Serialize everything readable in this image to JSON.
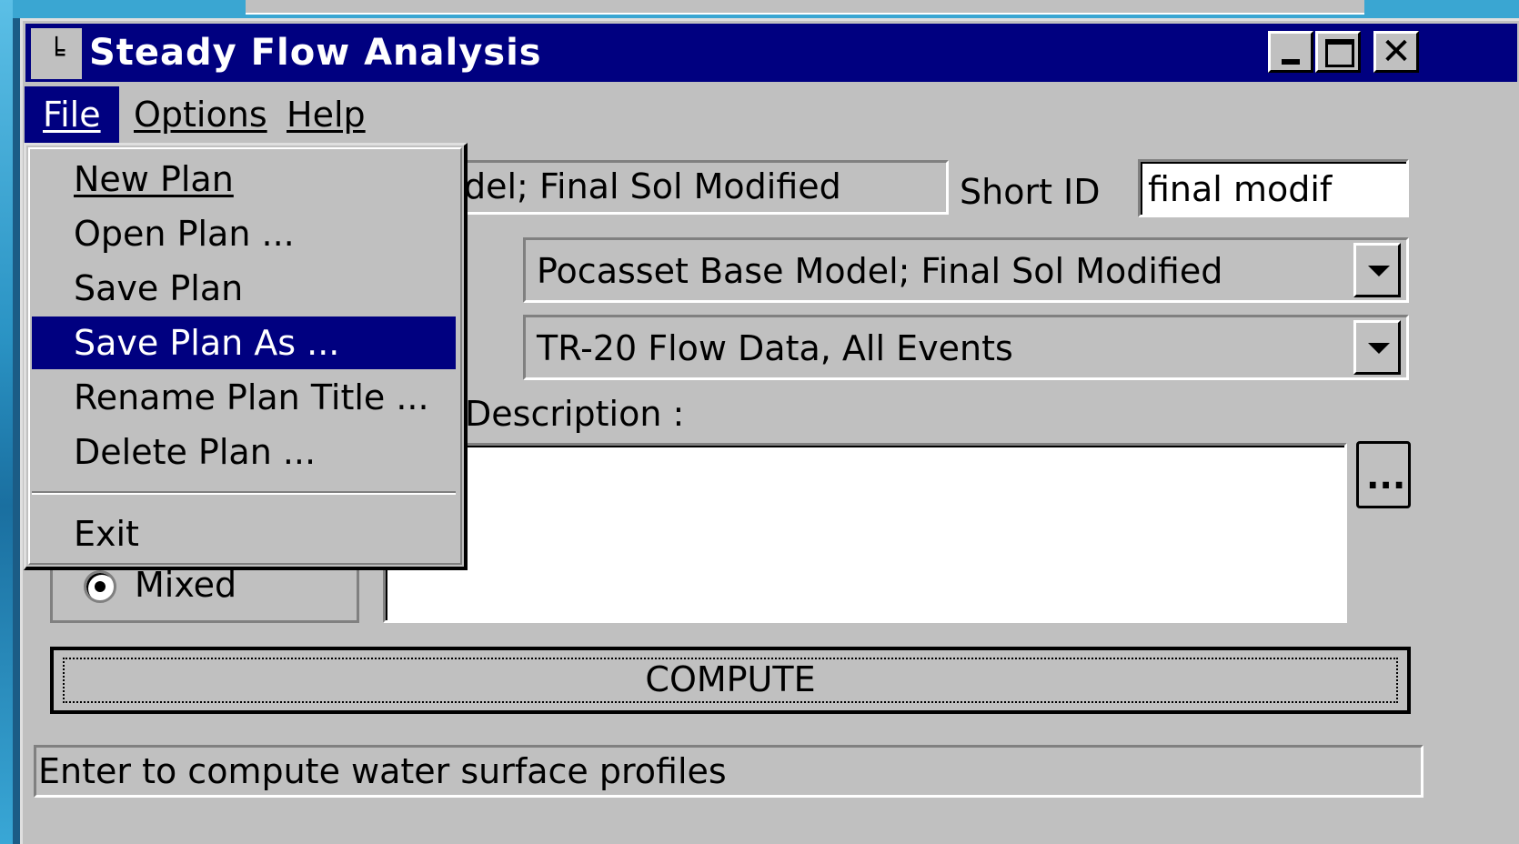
{
  "window": {
    "title": "Steady Flow Analysis",
    "icon_glyph": "╘",
    "close_glyph": "✕"
  },
  "menubar": {
    "items": [
      {
        "label": "File",
        "active": true
      },
      {
        "label": "Options",
        "active": false
      },
      {
        "label": "Help",
        "active": false
      }
    ]
  },
  "file_menu": {
    "items": [
      {
        "label": "New Plan",
        "selected": false
      },
      {
        "label": "Open Plan ...",
        "selected": false
      },
      {
        "label": "Save Plan",
        "selected": false
      },
      {
        "label": "Save Plan As ...",
        "selected": true
      },
      {
        "label": "Rename Plan Title ...",
        "selected": false
      },
      {
        "label": "Delete Plan ...",
        "selected": false
      },
      {
        "label": "Exit",
        "selected": false
      }
    ]
  },
  "plan": {
    "title_visible": "del; Final Sol Modified",
    "short_id_label": "Short ID",
    "short_id_value": "final modif"
  },
  "geometry_file": {
    "value": "Pocasset Base Model; Final Sol Modified"
  },
  "flow_file": {
    "value": "TR-20 Flow Data, All Events"
  },
  "description": {
    "label_visible": "Description :",
    "value": "",
    "ellipsis_button": "..."
  },
  "flow_regime": {
    "selected": "Mixed",
    "option_label": "Mixed"
  },
  "compute": {
    "label": "COMPUTE"
  },
  "status": {
    "text": "Enter to compute water surface profiles"
  },
  "colors": {
    "titlebar": "#000080",
    "face": "#c0c0c0",
    "desktop": "#3aa6d2"
  }
}
